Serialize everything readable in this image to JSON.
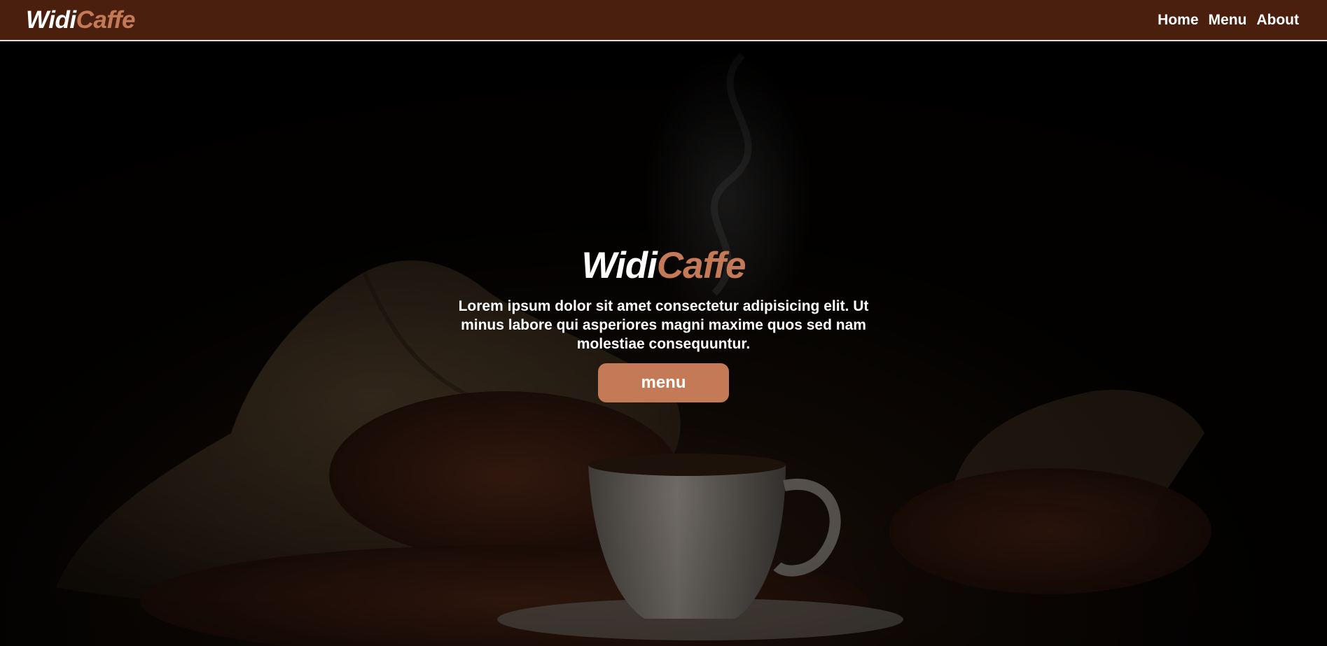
{
  "brand": {
    "part1": "Widi",
    "part2": "Caffe"
  },
  "nav": {
    "links": [
      "Home",
      "Menu",
      "About"
    ]
  },
  "hero": {
    "title_part1": "Widi",
    "title_part2": "Caffe",
    "text": "Lorem ipsum dolor sit amet consectetur adipisicing elit. Ut minus labore qui asperiores magni maxime quos sed nam molestiae consequuntur.",
    "button_label": "menu",
    "background_image": "coffee-beans-and-cup-photo"
  },
  "colors": {
    "navbar_bg": "#4a1f0e",
    "accent": "#c47a56",
    "text": "#ffffff"
  }
}
